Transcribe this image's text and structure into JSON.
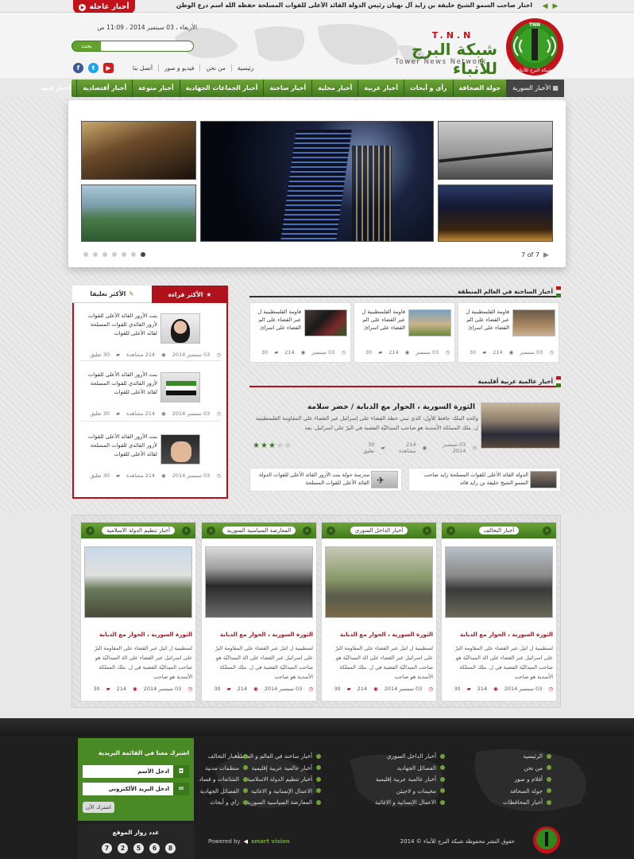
{
  "top": {
    "breaking_label": "أخبار عاجلة",
    "ticker": "اختار صاحب السمو الشيخ خليفة بن زايد آل نهيان رئيس الدولة القائد الأعلى للقوات المسلحة حفظه الله اسم درع الوطن"
  },
  "header": {
    "tnn": "T.N.N",
    "brand_name": "شبكة البرج للأنباء",
    "brand_en": "Tower News Network",
    "datetime": "الأربعاء ، 03 سبتمبر 2014 ، 11:09 ص",
    "search_placeholder": "",
    "search_button": "بحث",
    "top_links": [
      "رئيسية",
      "من نحن",
      "فيديو و صور",
      "أتصل بنا"
    ],
    "social": [
      "facebook-icon",
      "twitter-icon",
      "youtube-icon"
    ],
    "logo_text": "شبكة البرج للأنباء"
  },
  "nav": [
    "الأخبار السورية",
    "جولة الصحافة",
    "رأي و أبحاث",
    "أخبار عربية",
    "أخبار محلية",
    "أخبار ساخنة",
    "أخبار الجماعات الجهادية",
    "أخبار منوعة",
    "أخبار أقتصادية",
    "أخبار فنية"
  ],
  "slider": {
    "count": "7 of 7",
    "dots": 7
  },
  "region": {
    "title": "أخبار الساخنة في العالم المنطقة",
    "items": [
      {
        "text": "قاومة الفلسطينية ل عبر القضاء على الم القضاء على اسرائ",
        "date": "03 سبتمبر",
        "views": "214",
        "comments": "30"
      },
      {
        "text": "قاومة الفلسطينية ل عبر القضاء على الم القضاء على اسرائ",
        "date": "03 سبتمبر",
        "views": "214",
        "comments": "30"
      },
      {
        "text": "قاومة الفلسطينية ل عبر القضاء على الم القضاء على اسرائ",
        "date": "03 سبتمبر",
        "views": "214",
        "comments": "30"
      }
    ]
  },
  "world": {
    "title": "أخبار عالمية عربية أقليمية",
    "headline": "الثورة السورية ، الحوار مع الدبابة / خضر سلامة",
    "excerpt": "والحد الملك حافظ للأول، الذي تبني خطة القضاء على إسرائيل عبر القضاء على المقاومة الفلسطينية ل. ملك المملكة الأسدية هو صاحب الميداليّة الفضية في البرّ على اسرائيل. بعد",
    "date": "03 سبتمبر 2014",
    "views": "214 مشاهدة",
    "comments": "30 تعليق",
    "rating": 3,
    "more": [
      "الدولة القائد الأعلى للقوات المسلحة زايد صاحب السمو الشيخ خليفة بن زايد قائد",
      "مدرسة حولة بنت الأزور القائد الأعلى للقوات الدولة القائد الأعلى للقوات المسلحة"
    ]
  },
  "tabs": {
    "most_read": "الأكثر قراءة",
    "most_commented": "الأكثر تعليقا",
    "items": [
      {
        "text": "بنت الأزور القائد الأعلى للقوات لأزور القائدي للقوات المسلحة لقائد الأعلى للقوات",
        "date": "03 سبتمبر 2014",
        "views": "214 مشاهدة",
        "comments": "30 تعليق"
      },
      {
        "text": "بنت الأزور القائد الأعلى للقوات لأزور القائدي للقوات المسلحة لقائد الأعلى للقوات",
        "date": "03 سبتمبر 2014",
        "views": "214 مشاهدة",
        "comments": "30 تعليق"
      },
      {
        "text": "بنت الأزور القائد الأعلى للقوات لأزور القائدي للقوات المسلحة لقائد الأعلى للقوات",
        "date": "03 سبتمبر 2014",
        "views": "214 مشاهدة",
        "comments": "30 تعليق"
      }
    ]
  },
  "columns": [
    {
      "name": "أخبار التحالف",
      "headline": "الثورة السورية ، الحوار مع الدبابة",
      "excerpt": "لسطينية ل ائيل عبر القضاء على المقاومة البرّ على اسرائيل عبر القضاء على الة الميداليّة هو صاحب الميداليّة الفضية في ل. ملك المملكة الأسدية هو صاحب",
      "date": "03 سبتمبر 2014",
      "views": "214",
      "comments": "30"
    },
    {
      "name": "أخبار الداخل السوري",
      "headline": "الثورة السورية ، الحوار مع الدبابة",
      "excerpt": "لسطينية ل ائيل عبر القضاء على المقاومة البرّ على اسرائيل عبر القضاء على الة الميداليّة هو صاحب الميداليّة الفضية في ل. ملك المملكة الأسدية هو صاحب",
      "date": "03 سبتمبر 2014",
      "views": "214",
      "comments": "30"
    },
    {
      "name": "المعارضة السياسية السورية",
      "headline": "الثورة السورية ، الحوار مع الدبابة",
      "excerpt": "لسطينية ل ائيل عبر القضاء على المقاومة البرّ على اسرائيل عبر القضاء على الة الميداليّة هو صاحب الميداليّة الفضية في ل. ملك المملكة الأسدية هو صاحب",
      "date": "03 سبتمبر 2014",
      "views": "214",
      "comments": "30"
    },
    {
      "name": "أخبار تنظيم الدولة الاسلامية",
      "headline": "الثورة السورية ، الحوار مع الدبابة",
      "excerpt": "لسطينية ل ائيل عبر القضاء على المقاومة البرّ على اسرائيل عبر القضاء على الة الميداليّة هو صاحب الميداليّة الفضية في ل. ملك المملكة الأسدية هو صاحب",
      "date": "03 سبتمبر 2014",
      "views": "214",
      "comments": "30"
    }
  ],
  "footer": {
    "links_col1": [
      "الرئيسية",
      "من نحن",
      "أفلام و صور",
      "جولة الصحافة",
      "أخبار المحافظات"
    ],
    "links_col2": [
      "أخبار الداخل السوري",
      "الفصائل الجهادية",
      "أخبار عالمية عربية إقليمية",
      "مخيمات و لاجيئن",
      "الاعمال الإنسانية و الاغاثية"
    ],
    "links_col3": [
      "أخبار ساخنة في العالم و المنطقة",
      "أخبار عالمية عربية إقليمية",
      "أخبار تنظيم الدولة الاسلامية",
      "الاعمال الإنسانية و الاغاثية",
      "المعارضة السياسية السورية"
    ],
    "links_col4": [
      "أخبار التحالف",
      "منظمات مدنية",
      "الشائعات و فساد",
      "الفصائل الجهادية",
      "راي و أبحاث"
    ],
    "subscribe_title": "اشترك معنا في القائمة البريدية",
    "name_placeholder": "ادخل الأسم",
    "email_placeholder": "ادخل البريد الألكتروني",
    "subscribe_button": "اشترك الآن",
    "visitors_label": "عدد زوار الموقع",
    "visitor_digits": [
      "7",
      "2",
      "5",
      "6",
      "8"
    ],
    "powered": "Powered by",
    "powered_brand": "smart vision",
    "copyright": "حقوق النشر محفوظة  شبكة البرج للأنباء © 2014"
  }
}
